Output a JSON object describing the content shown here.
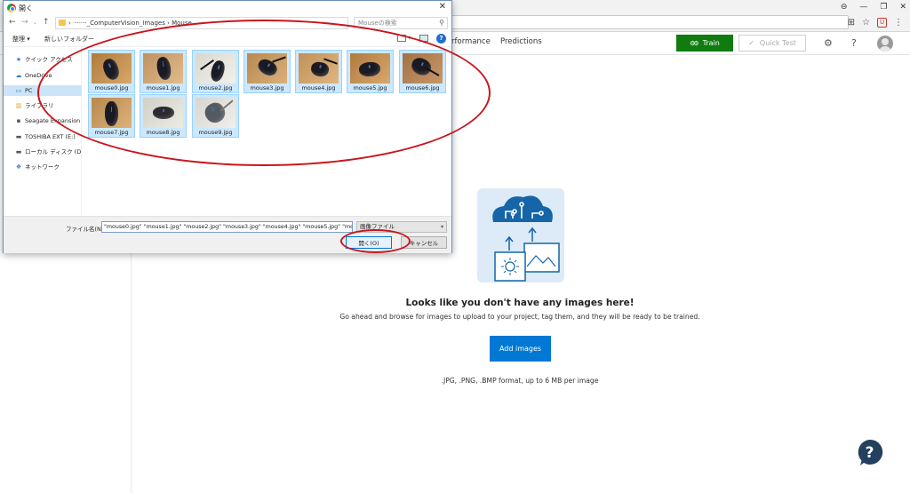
{
  "browser": {
    "window_controls": [
      "⊖",
      "—",
      "❐",
      "✕"
    ],
    "toolbar_icons": [
      "translate-icon",
      "star-icon",
      "extension-icon",
      "menu-icon"
    ]
  },
  "app": {
    "nav_tabs": [
      "rformance",
      "Predictions"
    ],
    "train_label": "Train",
    "quick_test_label": "Quick Test",
    "empty_title": "Looks like you don't have any images here!",
    "empty_desc": "Go ahead and browse for images to upload to your project, tag them, and they will be ready to be trained.",
    "add_images_label": "Add images",
    "format_note": ".JPG, .PNG, .BMP format, up to 6 MB per image",
    "accent_color": "#0078d4",
    "train_color": "#107c10"
  },
  "dialog": {
    "title": "開く",
    "address_path": "›         ·······_ComputerVision_Images  ›  Mouse",
    "search_placeholder": "Mouseの検索",
    "toolbar": {
      "organize": "整理 ▾",
      "new_folder": "新しいフォルダー"
    },
    "nav_items": [
      {
        "label": "クイック アクセス",
        "icon": "★",
        "color": "#3a78c6"
      },
      {
        "label": "OneDrive",
        "icon": "☁",
        "color": "#2b7cd3"
      },
      {
        "label": "PC",
        "icon": "▭",
        "color": "#3a78c6",
        "selected": true
      },
      {
        "label": "ライブラリ",
        "icon": "▥",
        "color": "#d9a929"
      },
      {
        "label": "Seagate Expansion Drive",
        "icon": "▪",
        "color": "#555"
      },
      {
        "label": "TOSHIBA EXT (E:)",
        "icon": "▬",
        "color": "#555"
      },
      {
        "label": "ローカル ディスク (D:)",
        "icon": "▬",
        "color": "#555"
      },
      {
        "label": "ネットワーク",
        "icon": "❖",
        "color": "#3a78c6"
      }
    ],
    "files": [
      "mouse0.jpg",
      "mouse1.jpg",
      "mouse2.jpg",
      "mouse3.jpg",
      "mouse4.jpg",
      "mouse5.jpg",
      "mouse6.jpg",
      "mouse7.jpg",
      "mouse8.jpg",
      "mouse9.jpg"
    ],
    "filename_label": "ファイル名(N):",
    "filename_value": "\"mouse0.jpg\" \"mouse1.jpg\" \"mouse2.jpg\" \"mouse3.jpg\" \"mouse4.jpg\" \"mouse5.jpg\" \"mouse6.jp",
    "file_type": "画像ファイル",
    "open_label": "開く(O)",
    "cancel_label": "キャンセル"
  }
}
